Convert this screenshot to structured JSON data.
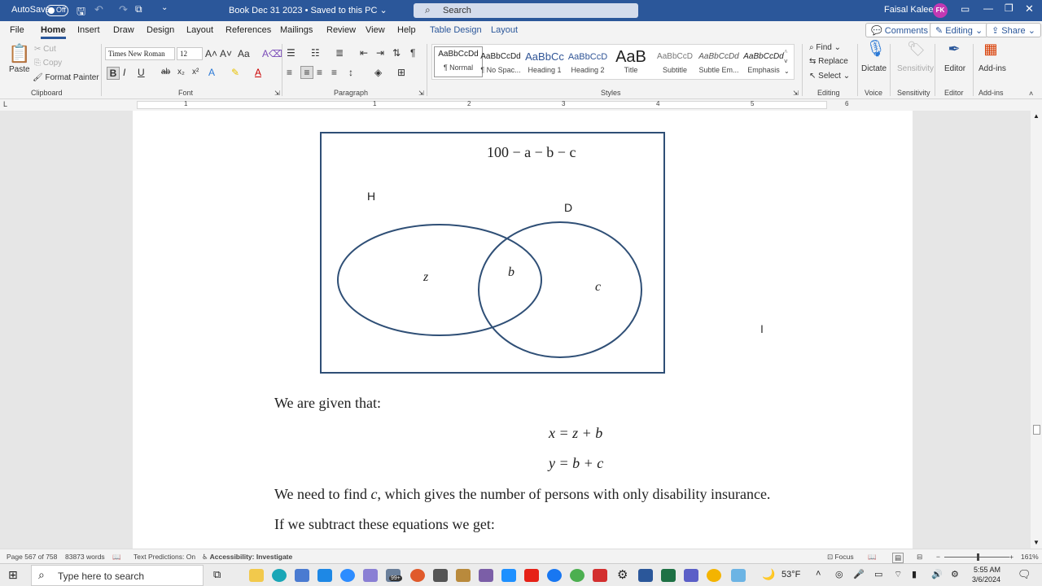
{
  "titlebar": {
    "autosave_label": "AutoSave",
    "autosave_state": "Off",
    "doc_title": "Book Dec 31 2023 • Saved to this PC ⌄",
    "search_placeholder": "Search",
    "user_name": "Faisal Kaleem",
    "user_initials": "FK"
  },
  "tabs": [
    "File",
    "Home",
    "Insert",
    "Draw",
    "Design",
    "Layout",
    "References",
    "Mailings",
    "Review",
    "View",
    "Help",
    "Table Design",
    "Layout"
  ],
  "tab_buttons": {
    "comments": "Comments",
    "editing": "Editing",
    "share": "Share"
  },
  "ribbon": {
    "clipboard": {
      "paste": "Paste",
      "cut": "Cut",
      "copy": "Copy",
      "format_painter": "Format Painter",
      "label": "Clipboard"
    },
    "font": {
      "name": "Times New Roman",
      "size": "12",
      "label": "Font"
    },
    "paragraph": {
      "label": "Paragraph"
    },
    "styles": {
      "label": "Styles",
      "items": [
        {
          "preview": "AaBbCcDd",
          "name": "¶ Normal"
        },
        {
          "preview": "AaBbCcDd",
          "name": "¶ No Spac..."
        },
        {
          "preview": "AaBbCc",
          "name": "Heading 1"
        },
        {
          "preview": "AaBbCcD",
          "name": "Heading 2"
        },
        {
          "preview": "AaB",
          "name": "Title"
        },
        {
          "preview": "AaBbCcD",
          "name": "Subtitle"
        },
        {
          "preview": "AaBbCcDd",
          "name": "Subtle Em..."
        },
        {
          "preview": "AaBbCcDd",
          "name": "Emphasis"
        }
      ]
    },
    "editing": {
      "find": "Find",
      "replace": "Replace",
      "select": "Select",
      "label": "Editing"
    },
    "voice": {
      "dictate": "Dictate",
      "label": "Voice"
    },
    "sensitivity": {
      "button": "Sensitivity",
      "label": "Sensitivity"
    },
    "editor": {
      "button": "Editor",
      "label": "Editor"
    },
    "addins": {
      "button": "Add-ins",
      "label": "Add-ins"
    }
  },
  "ruler_numbers": [
    "1",
    "1",
    "2",
    "3",
    "4",
    "5",
    "6"
  ],
  "diagram": {
    "top_label": "100 − a − b − c",
    "set_h": "H",
    "set_d": "D",
    "region_z": "z",
    "region_b": "b",
    "region_c": "c"
  },
  "document": {
    "p1": "We are given that:",
    "eq1": "x = z + b",
    "eq2": "y = b + c",
    "p2_before": "We need to find ",
    "p2_var": "c",
    "p2_after": ", which gives the number of persons with only disability insurance.",
    "p3": "If we subtract these equations we get:"
  },
  "status": {
    "page": "Page 567 of 758",
    "words": "83873 words",
    "predictions": "Text Predictions: On",
    "accessibility": "Accessibility: Investigate",
    "focus": "Focus",
    "zoom": "161%"
  },
  "taskbar": {
    "search_placeholder": "Type here to search",
    "badge": "99+",
    "temperature": "53°F",
    "time": "5:55 AM",
    "date": "3/6/2024"
  }
}
